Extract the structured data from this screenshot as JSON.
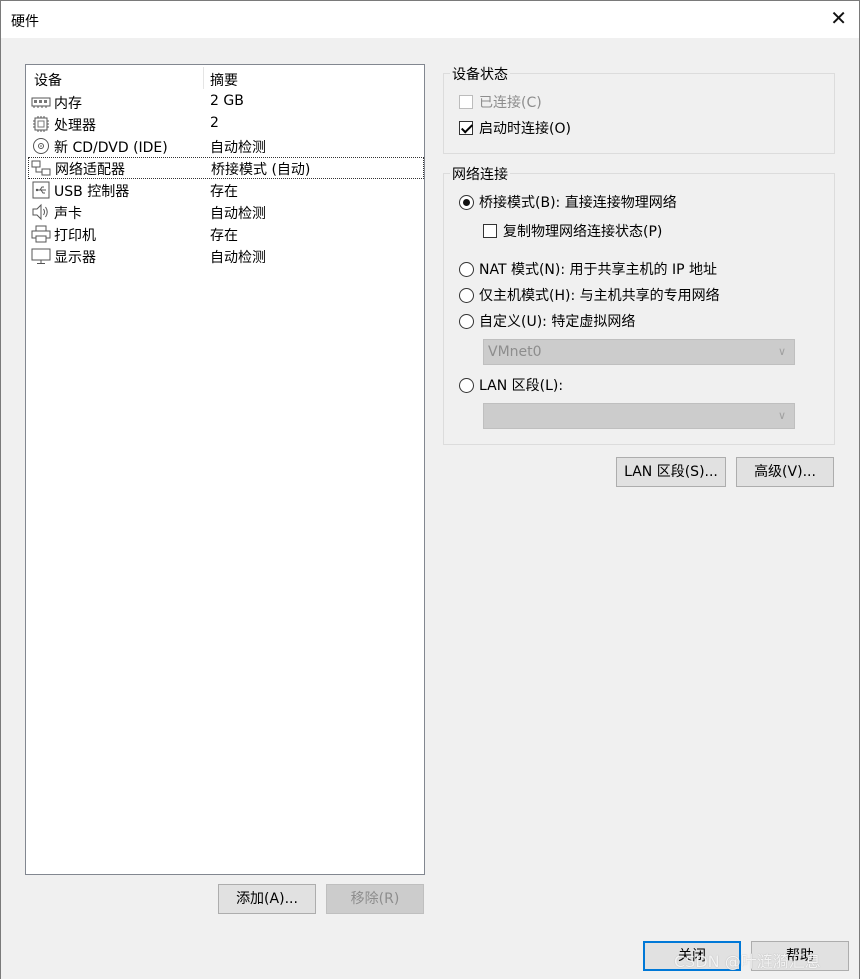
{
  "window": {
    "title": "硬件",
    "close_glyph": "✕"
  },
  "device_list": {
    "columns": {
      "device": "设备",
      "summary": "摘要"
    },
    "rows": [
      {
        "name": "内存",
        "summary": "2 GB",
        "icon": "memory-icon"
      },
      {
        "name": "处理器",
        "summary": "2",
        "icon": "processor-icon"
      },
      {
        "name": "新 CD/DVD (IDE)",
        "summary": "自动检测",
        "icon": "cd-dvd-icon"
      },
      {
        "name": "网络适配器",
        "summary": "桥接模式 (自动)",
        "icon": "network-adapter-icon",
        "selected": true
      },
      {
        "name": "USB 控制器",
        "summary": "存在",
        "icon": "usb-icon"
      },
      {
        "name": "声卡",
        "summary": "自动检测",
        "icon": "speaker-icon"
      },
      {
        "name": "打印机",
        "summary": "存在",
        "icon": "printer-icon"
      },
      {
        "name": "显示器",
        "summary": "自动检测",
        "icon": "monitor-icon"
      }
    ],
    "add_button": "添加(A)...",
    "remove_button": "移除(R)"
  },
  "device_status": {
    "label": "设备状态",
    "connected": {
      "label": "已连接(C)",
      "checked": false,
      "enabled": false
    },
    "connect_at_power_on": {
      "label": "启动时连接(O)",
      "checked": true,
      "enabled": true
    }
  },
  "network_connection": {
    "label": "网络连接",
    "bridged": {
      "label": "桥接模式(B): 直接连接物理网络",
      "checked": true
    },
    "replicate": {
      "label": "复制物理网络连接状态(P)",
      "checked": false
    },
    "nat": {
      "label": "NAT 模式(N): 用于共享主机的 IP 地址"
    },
    "host_only": {
      "label": "仅主机模式(H): 与主机共享的专用网络"
    },
    "custom": {
      "label": "自定义(U): 特定虚拟网络"
    },
    "vmnet_value": "VMnet0",
    "lan_segment": {
      "label": "LAN 区段(L):"
    },
    "lan_segment_value": ""
  },
  "buttons": {
    "lan_segments": "LAN 区段(S)...",
    "advanced": "高级(V)...",
    "close": "关闭",
    "help": "帮助"
  },
  "watermark": "CSDN @叶涟漪汇息",
  "colors": {
    "dialog_bg": "#f0f0f0",
    "default_button_border": "#0078d7",
    "disabled_text": "#8d8d8d"
  }
}
